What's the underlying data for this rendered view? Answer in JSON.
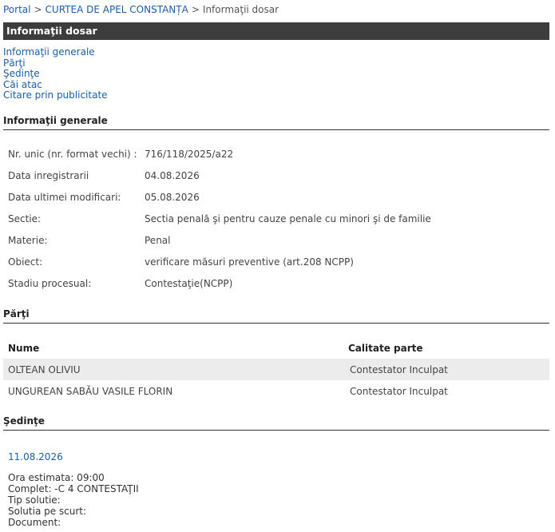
{
  "breadcrumb": {
    "portal": "Portal",
    "court": "CURTEA DE APEL CONSTANȚA",
    "current": "Informaţii dosar",
    "sep": ">"
  },
  "title": "Informaţii dosar",
  "toc": [
    "Informaţii generale",
    "Părţi",
    "Şedinţe",
    "Căi atac",
    "Citare prin publicitate"
  ],
  "general": {
    "heading": "Informaţii generale",
    "fields": [
      {
        "label": "Nr. unic (nr. format vechi) :",
        "value": "716/118/2025/a22"
      },
      {
        "label": "Data inregistrarii",
        "value": "04.08.2026"
      },
      {
        "label": "Data ultimei modificari:",
        "value": "05.08.2026"
      },
      {
        "label": "Sectie:",
        "value": "Sectia penală şi pentru cauze penale cu minori şi de familie"
      },
      {
        "label": "Materie:",
        "value": "Penal"
      },
      {
        "label": "Obiect:",
        "value": "verificare măsuri preventive (art.208 NCPP)"
      },
      {
        "label": "Stadiu procesual:",
        "value": "Contestaţie(NCPP)"
      }
    ]
  },
  "parti": {
    "heading": "Părţi",
    "columns": [
      "Nume",
      "Calitate parte"
    ],
    "rows": [
      [
        "OLTEAN OLIVIU",
        "Contestator Inculpat"
      ],
      [
        "UNGUREAN SABĂU VASILE FLORIN",
        "Contestator Inculpat"
      ]
    ]
  },
  "sedinte": {
    "heading": "Şedinţe",
    "date": "11.08.2026",
    "lines": [
      "Ora estimata: 09:00",
      "Complet: -C 4 CONTESTAŢII",
      "Tip solutie:",
      "Solutia pe scurt:",
      "Document:"
    ]
  }
}
